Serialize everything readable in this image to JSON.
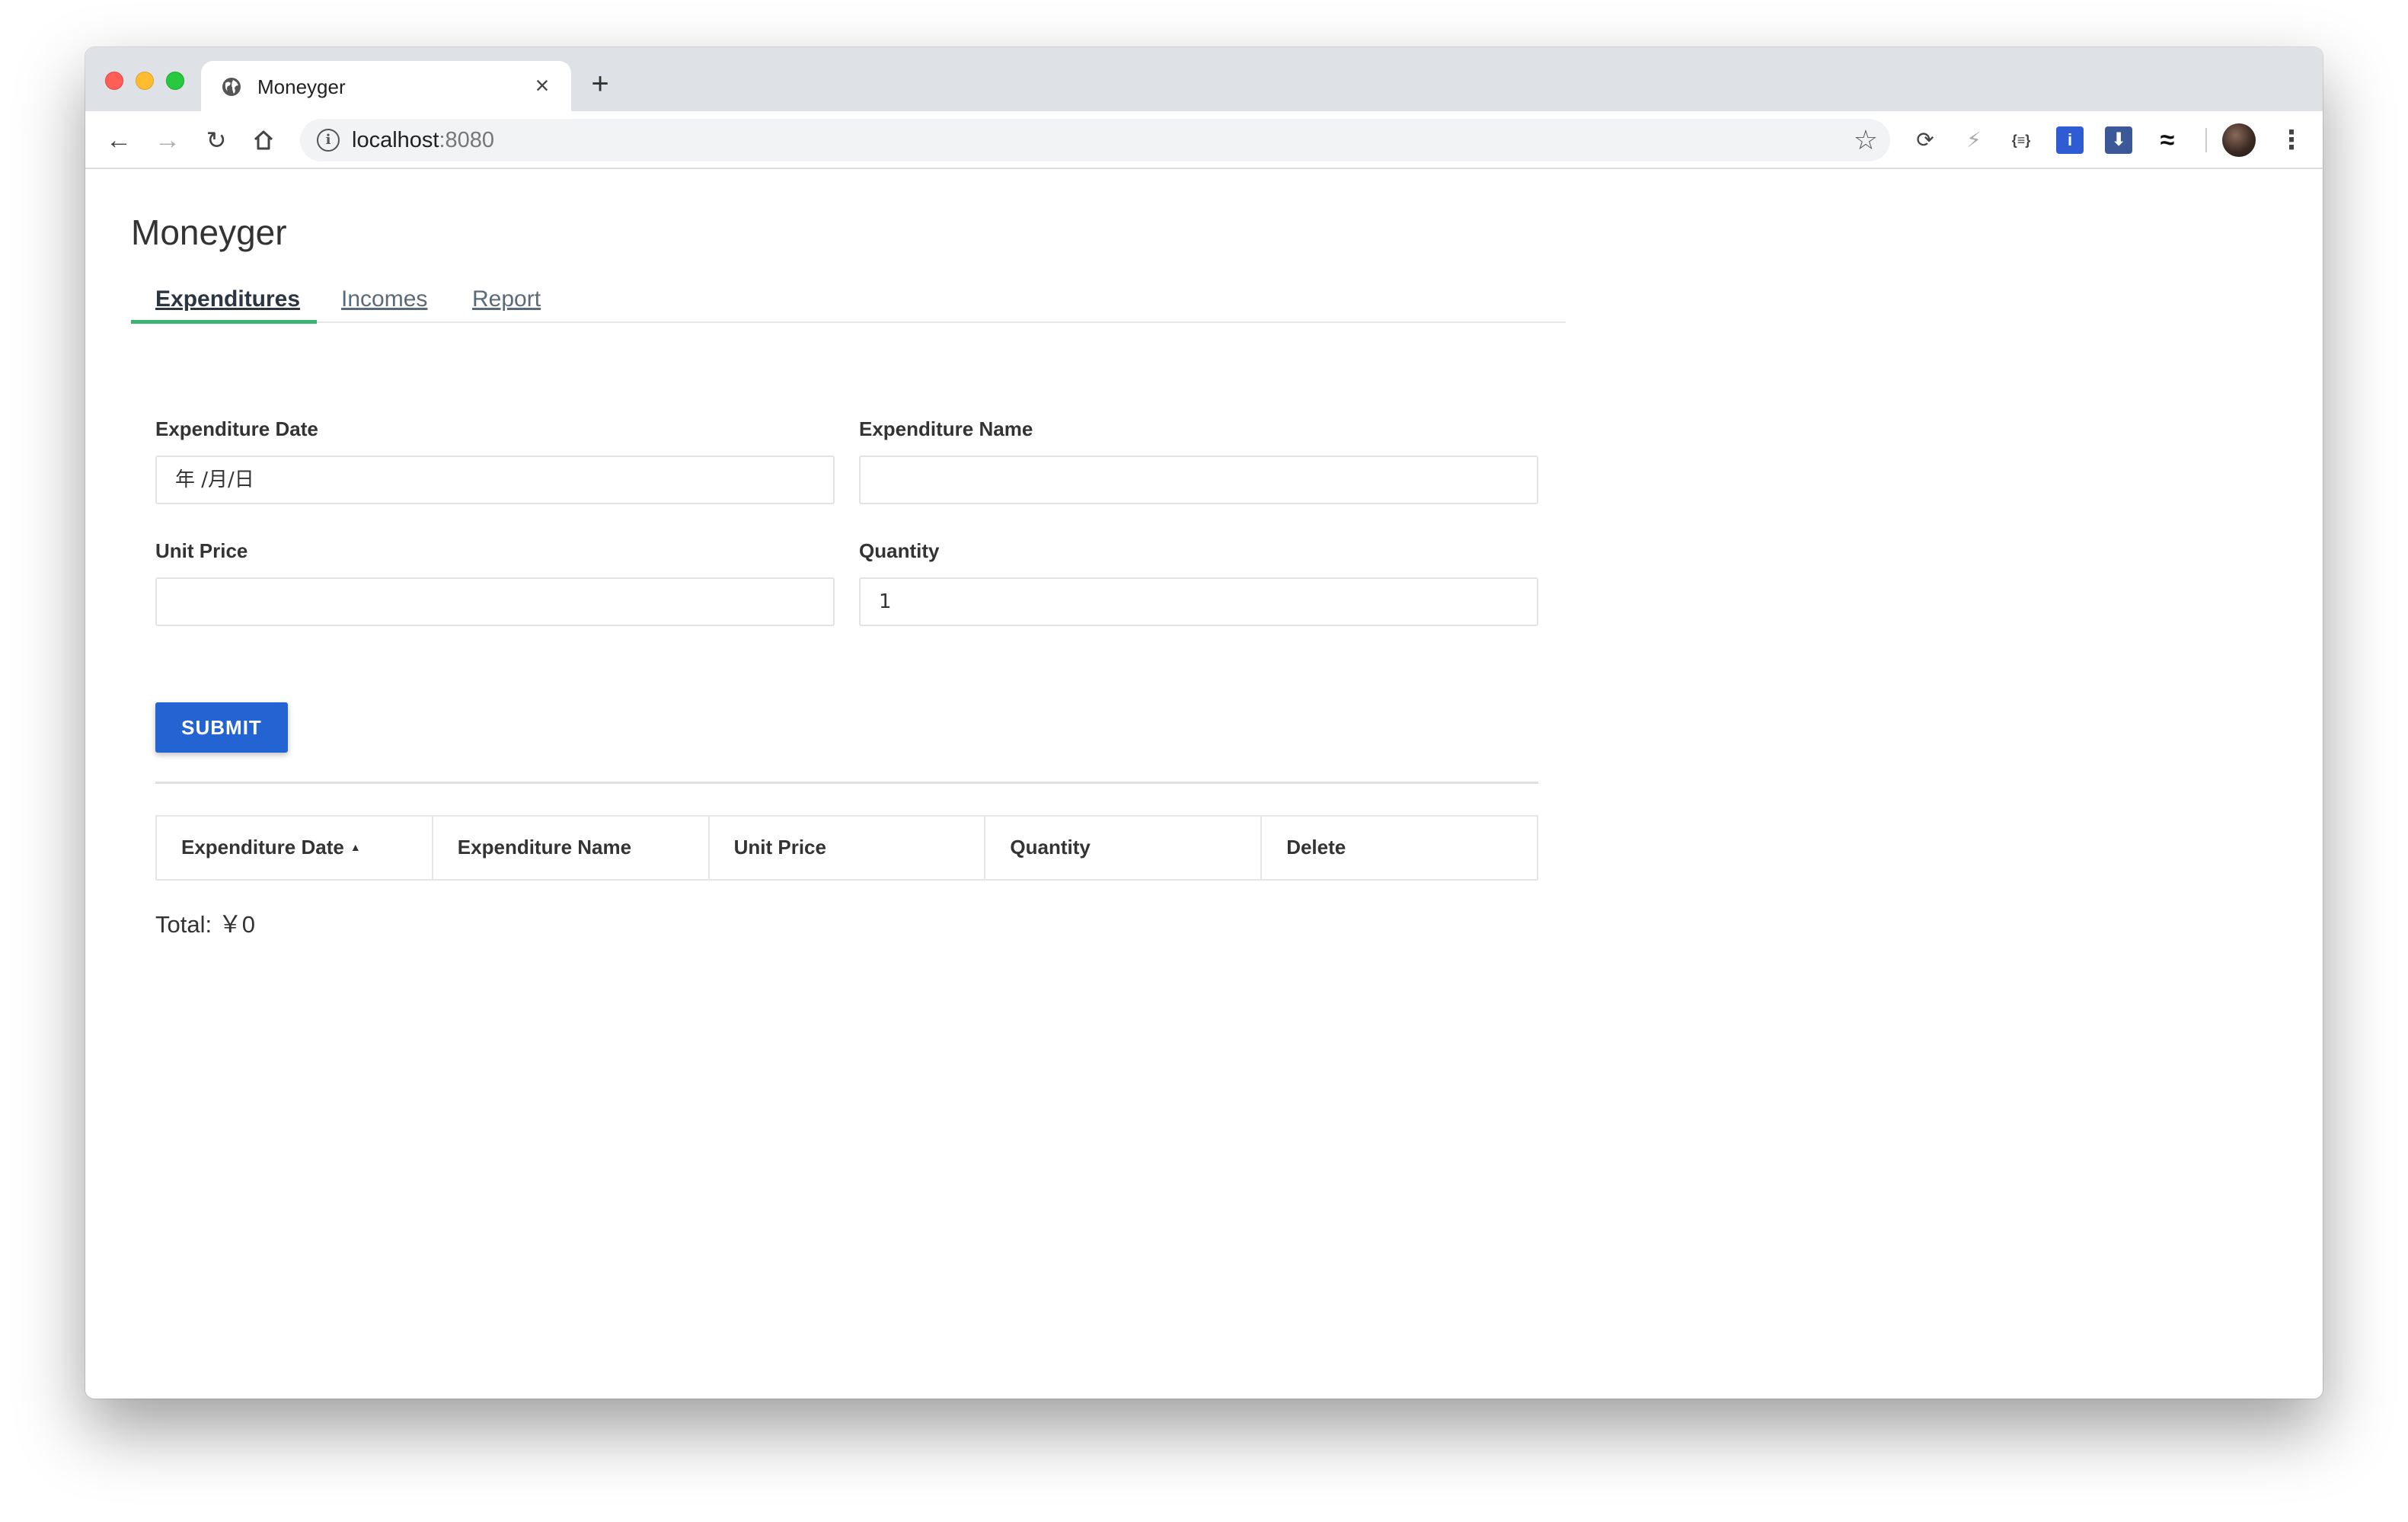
{
  "browser": {
    "tab_title": "Moneyger",
    "tab_close": "×",
    "new_tab": "+",
    "url_host": "localhost",
    "url_port": ":8080"
  },
  "app": {
    "title": "Moneyger",
    "tabs": [
      {
        "label": "Expenditures",
        "active": true
      },
      {
        "label": "Incomes",
        "active": false
      },
      {
        "label": "Report",
        "active": false
      }
    ]
  },
  "form": {
    "date_label": "Expenditure Date",
    "date_value": "年 /月/日",
    "name_label": "Expenditure Name",
    "name_value": "",
    "unit_price_label": "Unit Price",
    "unit_price_value": "",
    "quantity_label": "Quantity",
    "quantity_value": "1",
    "submit_label": "SUBMIT"
  },
  "table": {
    "columns": [
      "Expenditure Date",
      "Expenditure Name",
      "Unit Price",
      "Quantity",
      "Delete"
    ],
    "sorted_column": "Expenditure Date",
    "rows": []
  },
  "summary": {
    "total_text": "Total: ￥0"
  },
  "colors": {
    "accent_green": "#3cb371",
    "submit_blue": "#2364d2"
  }
}
